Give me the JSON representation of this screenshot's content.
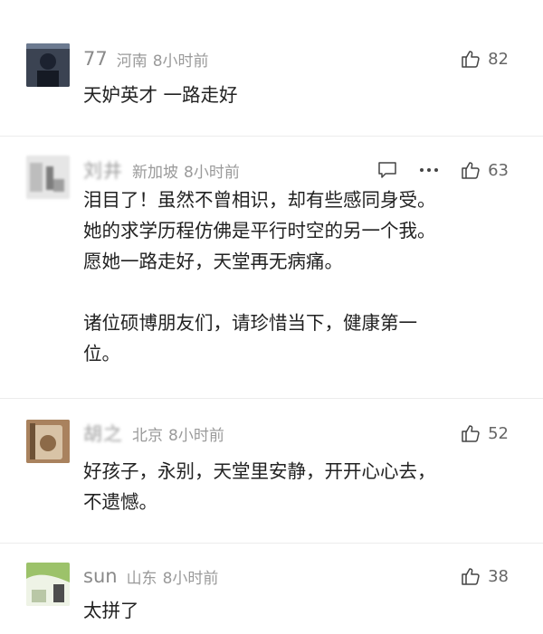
{
  "comments": [
    {
      "username": "77",
      "region": "河南",
      "time": "8小时前",
      "likes": "82",
      "text": "天妒英才 一路走好"
    },
    {
      "username": "刘井",
      "region": "新加坡",
      "time": "8小时前",
      "likes": "63",
      "paragraphs": [
        "泪目了！虽然不曾相识，却有些感同身受。",
        "她的求学历程仿佛是平行时空的另一个我。",
        "愿她一路走好，天堂再无病痛。",
        "诸位硕博朋友们，请珍惜当下，健康第一",
        "位。"
      ]
    },
    {
      "username": "胡之",
      "region": "北京",
      "time": "8小时前",
      "likes": "52",
      "paragraphs": [
        "好孩子，永别，天堂里安静，开开心心去，",
        "不遗憾。"
      ]
    },
    {
      "username": "sun",
      "region": "山东",
      "time": "8小时前",
      "likes": "38",
      "text": "太拼了"
    }
  ],
  "icons": {
    "like": "thumbs-up-icon",
    "reply": "comment-icon",
    "more": "more-icon"
  }
}
